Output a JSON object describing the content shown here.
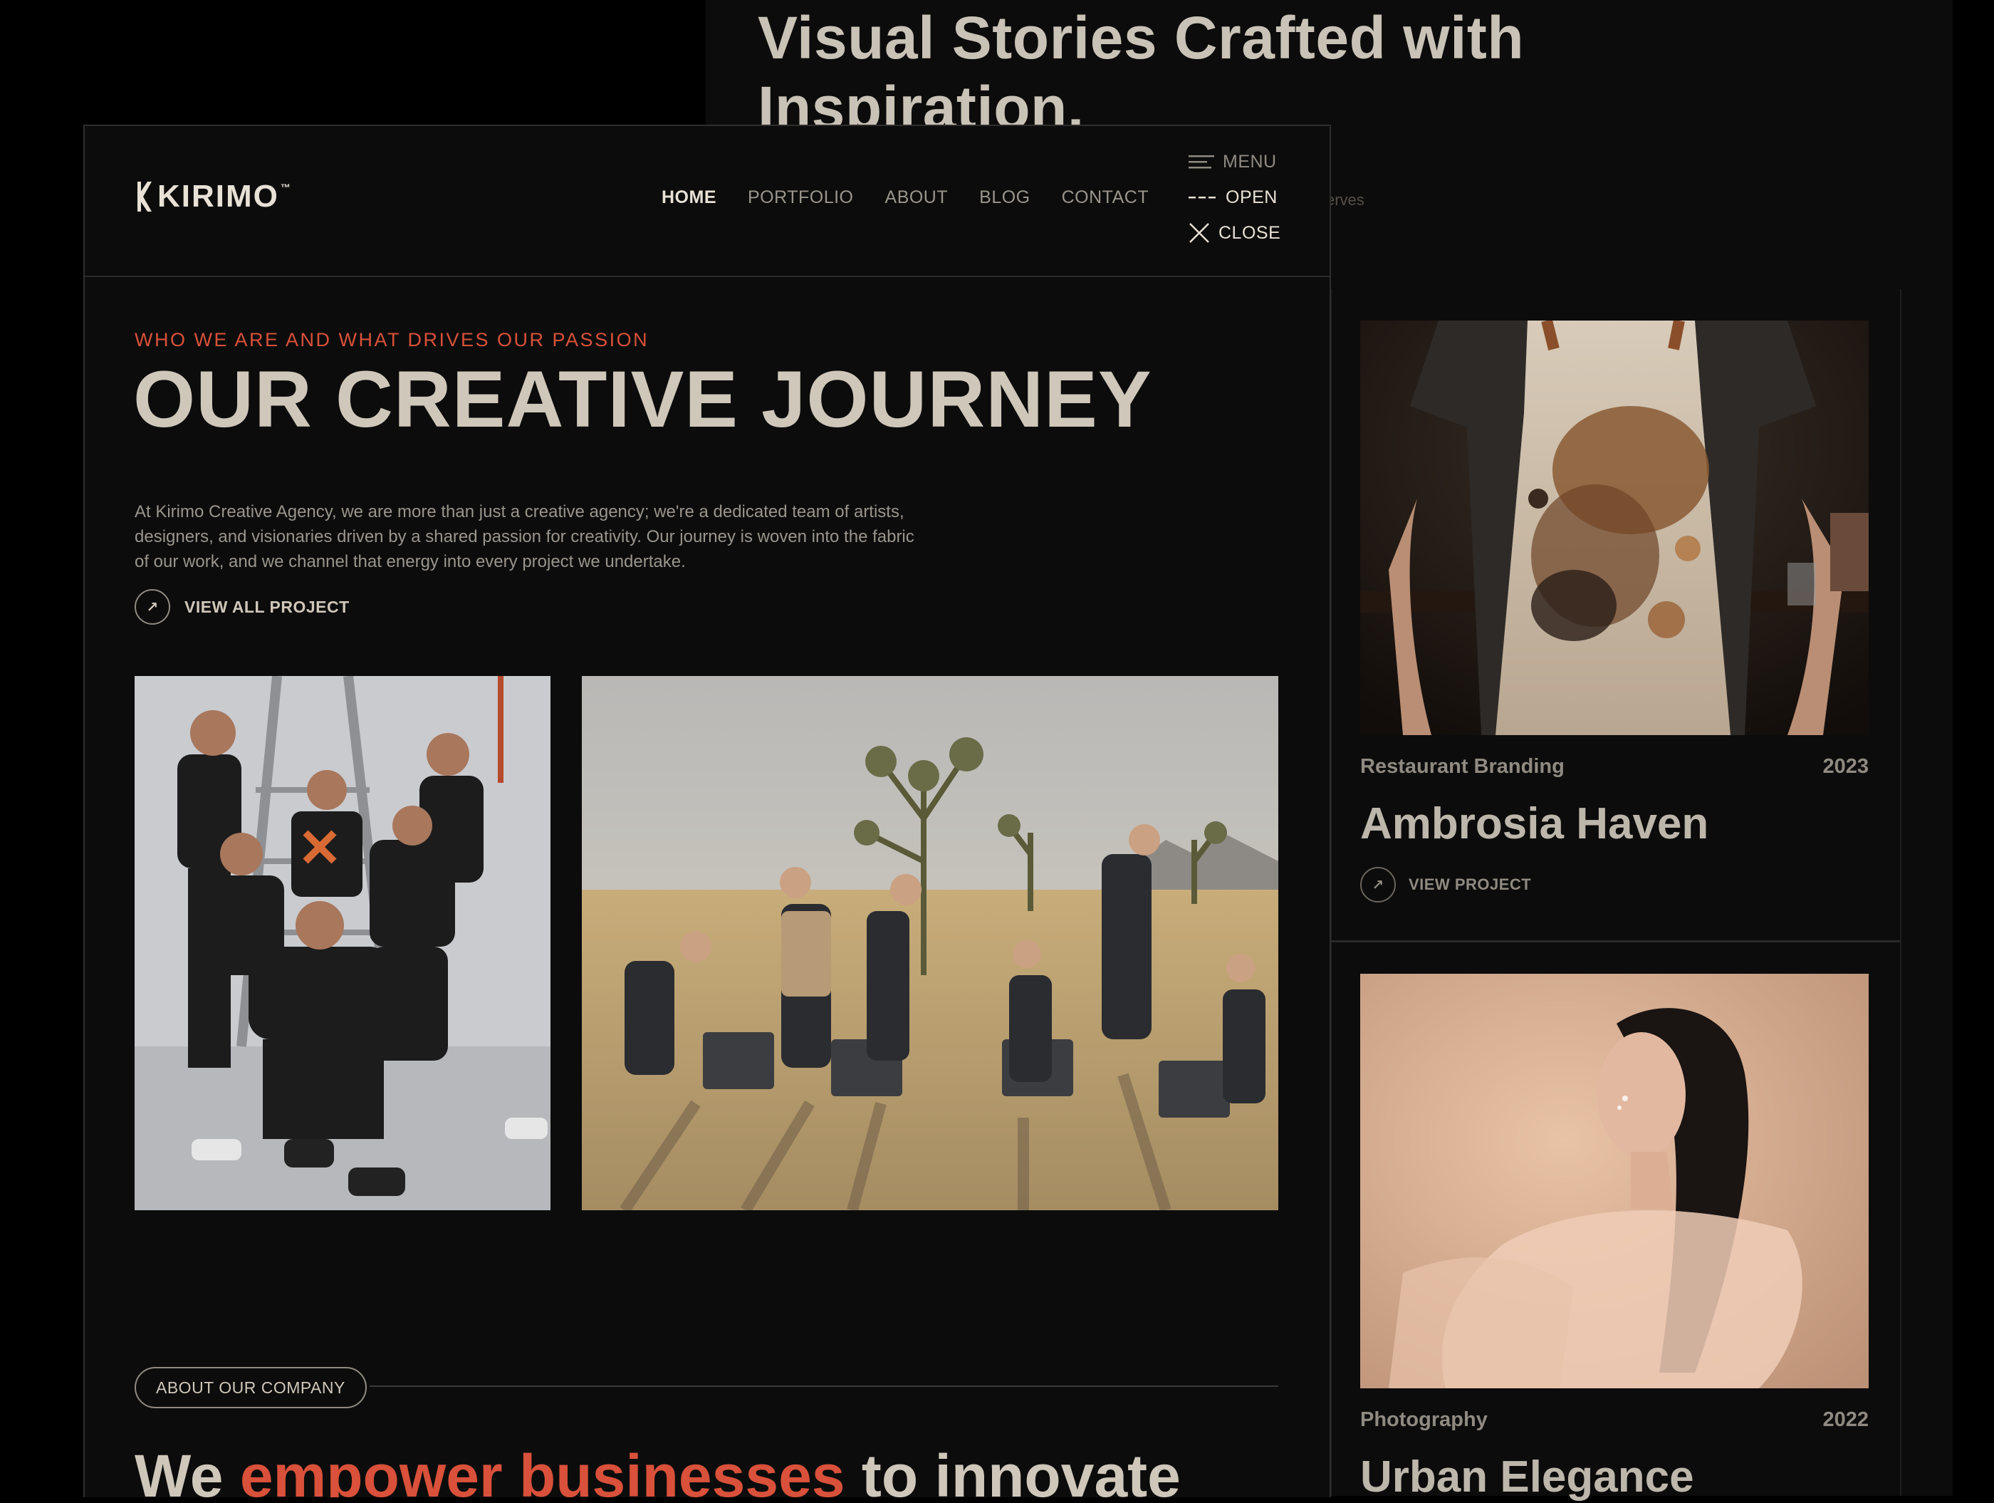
{
  "background_page": {
    "headline": "Visual Stories Crafted with Inspiration.",
    "faded_text": "erves",
    "faded_text_2": "",
    "cards": [
      {
        "category": "Restaurant Branding",
        "year": "2023",
        "title": "Ambrosia Haven",
        "cta": "VIEW PROJECT",
        "image": "apron-photo"
      },
      {
        "category": "Photography",
        "year": "2022",
        "title": "Urban Elegance",
        "image": "portrait-photo"
      }
    ]
  },
  "front_page": {
    "brand": {
      "name": "KIRIMO",
      "tm": "™"
    },
    "nav": {
      "items": [
        "HOME",
        "PORTFOLIO",
        "ABOUT",
        "BLOG",
        "CONTACT"
      ],
      "active": "HOME"
    },
    "menu_states": {
      "menu": "MENU",
      "open": "OPEN",
      "close": "CLOSE"
    },
    "hero": {
      "eyebrow": "WHO WE ARE AND WHAT DRIVES OUR PASSION",
      "title": "OUR CREATIVE JOURNEY",
      "body": "At Kirimo Creative Agency, we are more than just a creative agency; we're a dedicated team of artists, designers, and visionaries driven by a shared passion for creativity. Our journey is woven into the fabric of our work, and we channel that energy into every project we undertake.",
      "cta": "VIEW ALL PROJECT"
    },
    "photos": [
      "team-studio-photo",
      "desert-group-photo"
    ],
    "about": {
      "pill": "ABOUT OUR COMPANY",
      "headline_pre": "We ",
      "headline_accent": "empower businesses",
      "headline_post": " to innovate"
    }
  },
  "colors": {
    "background": "#0c0c0c",
    "accent": "#d9513a",
    "heading": "#cfc7ba",
    "muted": "#9a958d"
  }
}
